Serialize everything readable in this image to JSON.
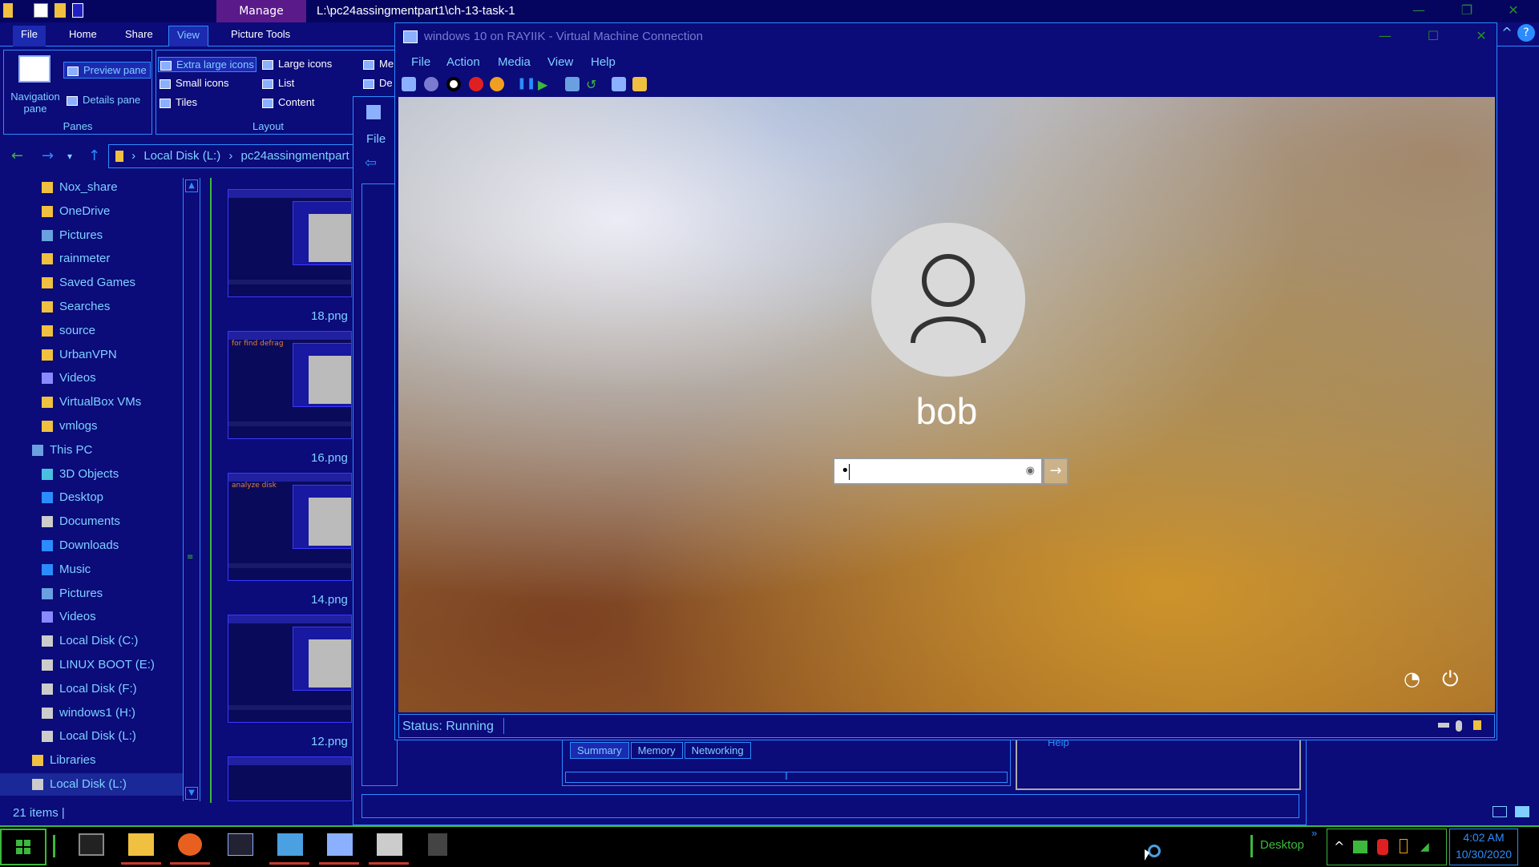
{
  "explorer": {
    "title_path": "L:\\pc24assingmentpart1\\ch-13-task-1",
    "manage_tab": "Manage",
    "tabs": [
      "File",
      "Home",
      "Share",
      "View",
      "Picture Tools"
    ],
    "active_tab": "View",
    "panes": {
      "navigation_pane": "Navigation pane",
      "preview_pane": "Preview pane",
      "details_pane": "Details pane",
      "group_label": "Panes"
    },
    "layout": {
      "items": [
        "Extra large icons",
        "Large icons",
        "Small icons",
        "List",
        "Tiles",
        "Content"
      ],
      "selected": "Extra large icons",
      "partial_1": "Me",
      "partial_2": "De",
      "group_label": "Layout"
    },
    "address": {
      "crumbs": [
        "Local Disk (L:)",
        "pc24assingmentpart"
      ]
    },
    "nav_items": [
      {
        "label": "Nox_share",
        "icon": "folder-icon"
      },
      {
        "label": "OneDrive",
        "icon": "folder-icon"
      },
      {
        "label": "Pictures",
        "icon": "pictures-icon"
      },
      {
        "label": "rainmeter",
        "icon": "folder-icon"
      },
      {
        "label": "Saved Games",
        "icon": "folder-icon"
      },
      {
        "label": "Searches",
        "icon": "search-folder-icon"
      },
      {
        "label": "source",
        "icon": "folder-icon"
      },
      {
        "label": "UrbanVPN",
        "icon": "folder-icon"
      },
      {
        "label": "Videos",
        "icon": "videos-icon"
      },
      {
        "label": "VirtualBox VMs",
        "icon": "folder-icon"
      },
      {
        "label": "vmlogs",
        "icon": "folder-icon"
      },
      {
        "label": "This PC",
        "icon": "computer-icon"
      },
      {
        "label": "3D Objects",
        "icon": "cube-icon"
      },
      {
        "label": "Desktop",
        "icon": "desktop-icon"
      },
      {
        "label": "Documents",
        "icon": "documents-icon"
      },
      {
        "label": "Downloads",
        "icon": "download-icon"
      },
      {
        "label": "Music",
        "icon": "music-icon"
      },
      {
        "label": "Pictures",
        "icon": "pictures-icon"
      },
      {
        "label": "Videos",
        "icon": "videos-icon"
      },
      {
        "label": "Local Disk (C:)",
        "icon": "drive-icon"
      },
      {
        "label": "LINUX BOOT (E:)",
        "icon": "drive-icon"
      },
      {
        "label": "Local Disk (F:)",
        "icon": "drive-icon"
      },
      {
        "label": "windows1 (H:)",
        "icon": "drive-icon"
      },
      {
        "label": "Local Disk (L:)",
        "icon": "drive-icon"
      },
      {
        "label": "Libraries",
        "icon": "libraries-icon"
      },
      {
        "label": "Local Disk (L:)",
        "icon": "drive-icon",
        "selected": true
      }
    ],
    "thumbs": [
      {
        "label": "18.png",
        "caption": ""
      },
      {
        "label": "16.png",
        "caption": "for find defrag"
      },
      {
        "label": "14.png",
        "caption": "analyze disk"
      },
      {
        "label": "12.png",
        "caption": ""
      }
    ],
    "status": "21 items"
  },
  "hv_manager": {
    "menu_file": "File",
    "tabs": [
      "Summary",
      "Memory",
      "Networking"
    ],
    "active_tab": "Summary",
    "partial_label": "Help"
  },
  "vm": {
    "title": "windows 10 on RAYIIK - Virtual Machine Connection",
    "menu": [
      "File",
      "Action",
      "Media",
      "View",
      "Help"
    ],
    "username": "bob",
    "password_mask": "•",
    "status": "Status: Running"
  },
  "taskbar": {
    "desktop_label": "Desktop",
    "time": "4:02 AM",
    "date": "10/30/2020",
    "apps": [
      "terminal-icon",
      "file-explorer-icon",
      "firefox-icon",
      "powershell-icon",
      "hyperv-icon",
      "network-icon",
      "server-icon",
      "app-icon"
    ]
  },
  "colors": {
    "window_bg": "#0b0b7a",
    "accent_green": "#3cb83c",
    "accent_blue": "#2c8cff",
    "text_cyan": "#7fd0ff",
    "manage_purple": "#5a1a8a"
  }
}
